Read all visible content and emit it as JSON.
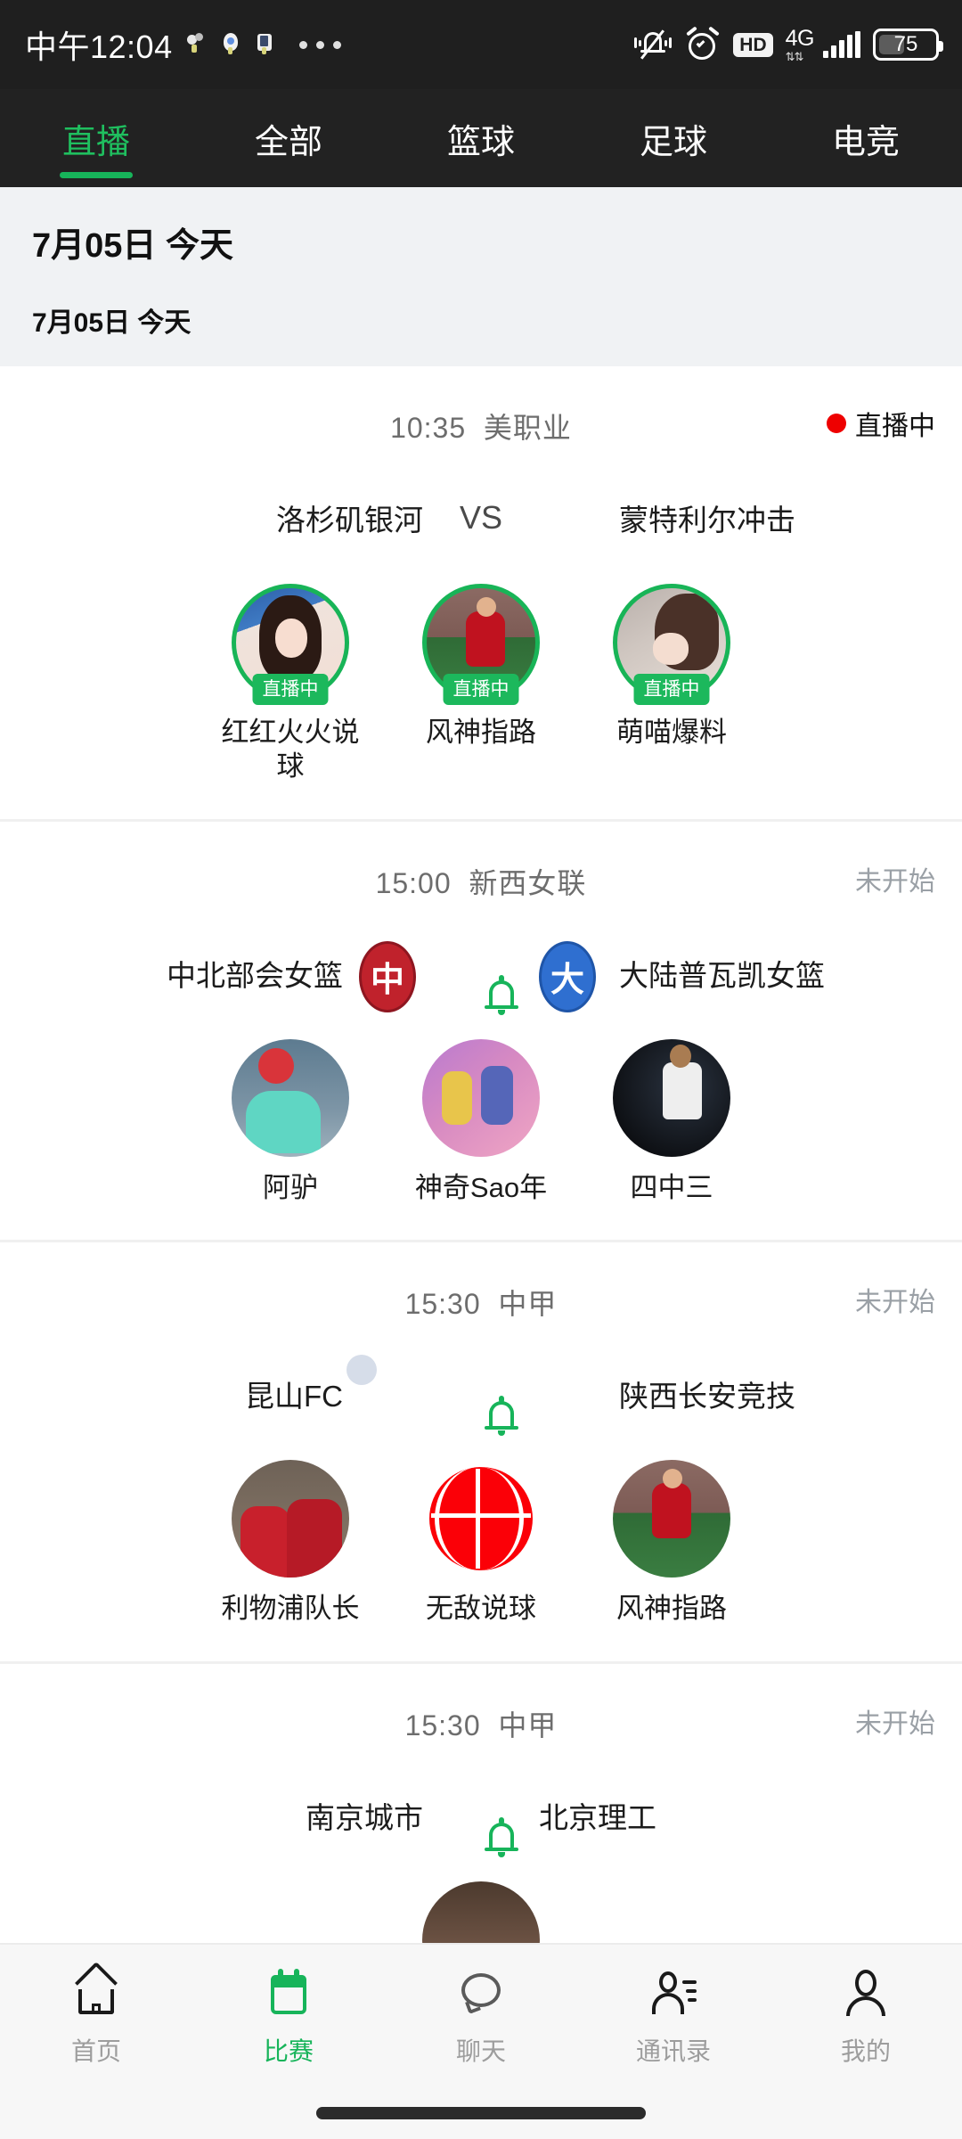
{
  "status_bar": {
    "time": "中午12:04",
    "network": "4G",
    "hd_label": "HD",
    "battery_percent": "75",
    "icons": [
      "notification-mini-1",
      "notification-mini-2",
      "notification-mini-3",
      "more-dots",
      "mute-bell-icon",
      "alarm-icon",
      "hd-icon",
      "signal-icon",
      "battery-icon"
    ]
  },
  "tabs": [
    {
      "label": "直播",
      "active": true
    },
    {
      "label": "全部",
      "active": false
    },
    {
      "label": "篮球",
      "active": false
    },
    {
      "label": "足球",
      "active": false
    },
    {
      "label": "电竞",
      "active": false
    }
  ],
  "date_headers": {
    "primary": "7月05日  今天",
    "secondary": "7月05日  今天"
  },
  "matches": [
    {
      "time": "10:35",
      "league": "美职业",
      "status": "直播中",
      "is_live": true,
      "home_team": "洛杉矶银河",
      "away_team": "蒙特利尔冲击",
      "middle_label": "VS",
      "streamers": [
        {
          "name": "红红火火说球",
          "live_badge": "直播中",
          "is_live": true
        },
        {
          "name": "风神指路",
          "live_badge": "直播中",
          "is_live": true
        },
        {
          "name": "萌喵爆料",
          "live_badge": "直播中",
          "is_live": true
        }
      ]
    },
    {
      "time": "15:00",
      "league": "新西女联",
      "status": "未开始",
      "is_live": false,
      "home_team": "中北部会女篮",
      "away_team": "大陆普瓦凯女篮",
      "home_logo_text": "中",
      "away_logo_text": "大",
      "streamers": [
        {
          "name": "阿驴",
          "is_live": false
        },
        {
          "name": "神奇Sao年",
          "is_live": false
        },
        {
          "name": "四中三",
          "is_live": false
        }
      ]
    },
    {
      "time": "15:30",
      "league": "中甲",
      "status": "未开始",
      "is_live": false,
      "home_team": "昆山FC",
      "away_team": "陕西长安竞技",
      "streamers": [
        {
          "name": "利物浦队长",
          "is_live": false
        },
        {
          "name": "无敌说球",
          "is_live": false
        },
        {
          "name": "风神指路",
          "is_live": false
        }
      ]
    },
    {
      "time": "15:30",
      "league": "中甲",
      "status": "未开始",
      "is_live": false,
      "home_team": "南京城市",
      "away_team": "北京理工",
      "streamers": []
    }
  ],
  "bottom_nav": [
    {
      "label": "首页",
      "icon": "home-icon",
      "active": false
    },
    {
      "label": "比赛",
      "icon": "calendar-icon",
      "active": true
    },
    {
      "label": "聊天",
      "icon": "chat-bubble-icon",
      "active": false
    },
    {
      "label": "通讯录",
      "icon": "contacts-icon",
      "active": false
    },
    {
      "label": "我的",
      "icon": "person-icon",
      "active": false
    }
  ],
  "colors": {
    "accent_green": "#17b45a",
    "live_red": "#ee0000",
    "status_bar_bg": "#1f1f1f",
    "tabbar_bg": "#222222",
    "date_zone_bg": "#f0f2f4",
    "muted_text": "#9aa0a6"
  }
}
